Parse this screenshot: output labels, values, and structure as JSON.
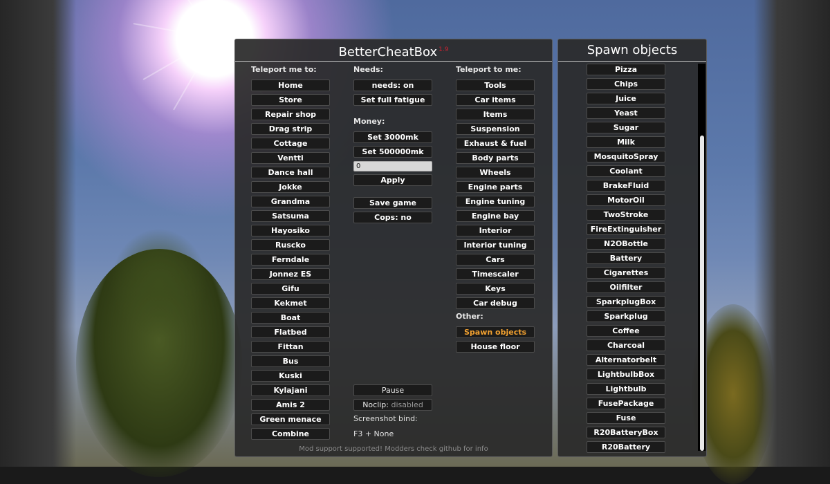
{
  "main_title": "BetterCheatBox",
  "version": "1.9",
  "teleport_me_to": {
    "label": "Teleport me to:",
    "items": [
      "Home",
      "Store",
      "Repair shop",
      "Drag strip",
      "Cottage",
      "Ventti",
      "Dance hall",
      "Jokke",
      "Grandma",
      "Satsuma",
      "Hayosiko",
      "Ruscko",
      "Ferndale",
      "Jonnez ES",
      "Gifu",
      "Kekmet",
      "Boat",
      "Flatbed",
      "Fittan",
      "Bus",
      "Kuski",
      "Kylajani",
      "Amis 2",
      "Green menace",
      "Combine"
    ]
  },
  "needs": {
    "label": "Needs:",
    "toggle": "needs: on",
    "fatigue": "Set full fatigue"
  },
  "money": {
    "label": "Money:",
    "set_3000": "Set 3000mk",
    "set_500000": "Set 500000mk",
    "input_value": "0",
    "apply": "Apply"
  },
  "save_game": "Save game",
  "cops": "Cops: no",
  "pause": "Pause",
  "noclip_label": "Noclip:",
  "noclip_state": "disabled",
  "screenshot_bind_label": "Screenshot bind:",
  "screenshot_bind_value": "F3 + None",
  "teleport_to_me": {
    "label": "Teleport to me:",
    "items": [
      "Tools",
      "Car items",
      "Items",
      "Suspension",
      "Exhaust & fuel",
      "Body parts",
      "Wheels",
      "Engine parts",
      "Engine tuning",
      "Engine bay",
      "Interior",
      "Interior tuning",
      "Cars",
      "Timescaler",
      "Keys",
      "Car debug"
    ]
  },
  "other": {
    "label": "Other:",
    "spawn_objects": "Spawn objects",
    "house_floor": "House floor"
  },
  "footer": "Mod support supported! Modders check github for info",
  "spawn_panel": {
    "title": "Spawn objects",
    "items": [
      "Pizza",
      "Chips",
      "Juice",
      "Yeast",
      "Sugar",
      "Milk",
      "MosquitoSpray",
      "Coolant",
      "BrakeFluid",
      "MotorOil",
      "TwoStroke",
      "FireExtinguisher",
      "N2OBottle",
      "Battery",
      "Cigarettes",
      "Oilfilter",
      "SparkplugBox",
      "Sparkplug",
      "Coffee",
      "Charcoal",
      "Alternatorbelt",
      "LightbulbBox",
      "Lightbulb",
      "FusePackage",
      "Fuse",
      "R20BatteryBox",
      "R20Battery"
    ]
  },
  "colors": {
    "accent_orange": "#f0a030",
    "version_red": "#cc2233",
    "panel_bg": "#2a2a2a"
  }
}
